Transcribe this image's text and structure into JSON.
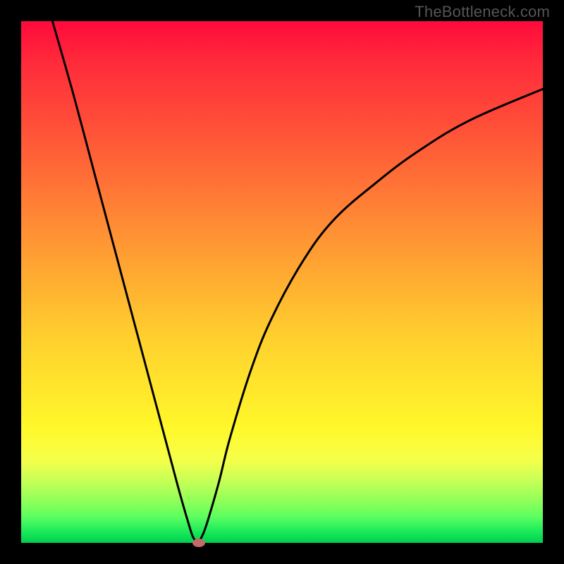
{
  "watermark": "TheBottleneck.com",
  "chart_data": {
    "type": "line",
    "title": "",
    "xlabel": "",
    "ylabel": "",
    "xlim": [
      0,
      100
    ],
    "ylim": [
      0,
      100
    ],
    "series": [
      {
        "name": "left-branch",
        "x": [
          6,
          10,
          14,
          18,
          22,
          26,
          30,
          32,
          33,
          34
        ],
        "values": [
          100,
          86,
          71,
          56,
          41,
          26,
          11,
          4,
          1,
          0
        ]
      },
      {
        "name": "right-branch",
        "x": [
          34,
          35,
          36,
          38,
          40,
          44,
          48,
          54,
          60,
          68,
          76,
          86,
          100
        ],
        "values": [
          0,
          2,
          5,
          12,
          20,
          33,
          43,
          54,
          62,
          69,
          75,
          81,
          87
        ]
      }
    ],
    "marker": {
      "x": 34,
      "y": 0,
      "color": "#c46a6a"
    },
    "background_gradient": {
      "type": "vertical",
      "stops": [
        {
          "pos": 0.0,
          "color": "#ff0a3c"
        },
        {
          "pos": 0.4,
          "color": "#ff8f34"
        },
        {
          "pos": 0.78,
          "color": "#fff82a"
        },
        {
          "pos": 1.0,
          "color": "#01cf4d"
        }
      ]
    }
  },
  "layout": {
    "outer": 800,
    "margin": 30,
    "inner": 740
  }
}
